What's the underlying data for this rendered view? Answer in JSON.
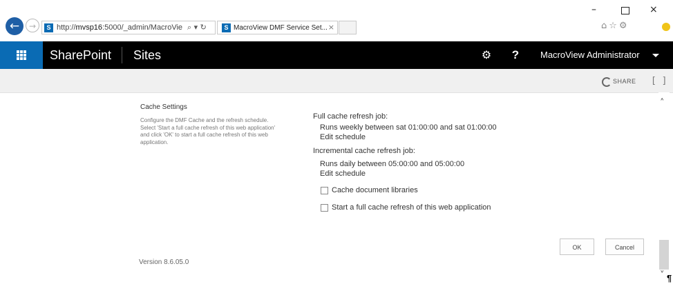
{
  "browser": {
    "url_plain_prefix": "http://",
    "url_host": "mvsp16",
    "url_rest": ":5000/_admin/MacroVie",
    "url_controls": "⌕ ▾ ↻",
    "tab_title": "MacroView DMF Service Set...",
    "tab_close": "×",
    "back_icon": "arrow-left-icon",
    "window_min": "–",
    "window_close": "×",
    "toolbar_icons": "⌂☆⚙"
  },
  "suite_bar": {
    "brand": "SharePoint",
    "sites": "Sites",
    "gear": "⚙",
    "help": "?",
    "user": "MacroView Administrator",
    "accent": "#0a6bb4"
  },
  "ribbon": {
    "share": "SHARE",
    "focus": "[ ]"
  },
  "section": {
    "title": "Cache Settings",
    "description": "Configure the DMF Cache and the refresh schedule. Select 'Start a full cache refresh of this web application' and click 'OK' to start a full cache refresh of this web application."
  },
  "full_refresh": {
    "label": "Full cache refresh job:",
    "schedule": "Runs weekly between sat 01:00:00 and sat 01:00:00",
    "edit": "Edit schedule"
  },
  "incremental_refresh": {
    "label": "Incremental cache refresh job:",
    "schedule": "Runs daily between 05:00:00 and 05:00:00",
    "edit": "Edit schedule"
  },
  "options": {
    "cache_doc_libraries": "Cache document libraries",
    "cache_doc_libraries_checked": false,
    "start_full_refresh": "Start a full cache refresh of this web application",
    "start_full_refresh_checked": false
  },
  "buttons": {
    "ok": "OK",
    "cancel": "Cancel"
  },
  "version": "Version 8.6.05.0",
  "scroll": {
    "up": "˄",
    "down": "˅"
  },
  "pilcrow": "¶"
}
